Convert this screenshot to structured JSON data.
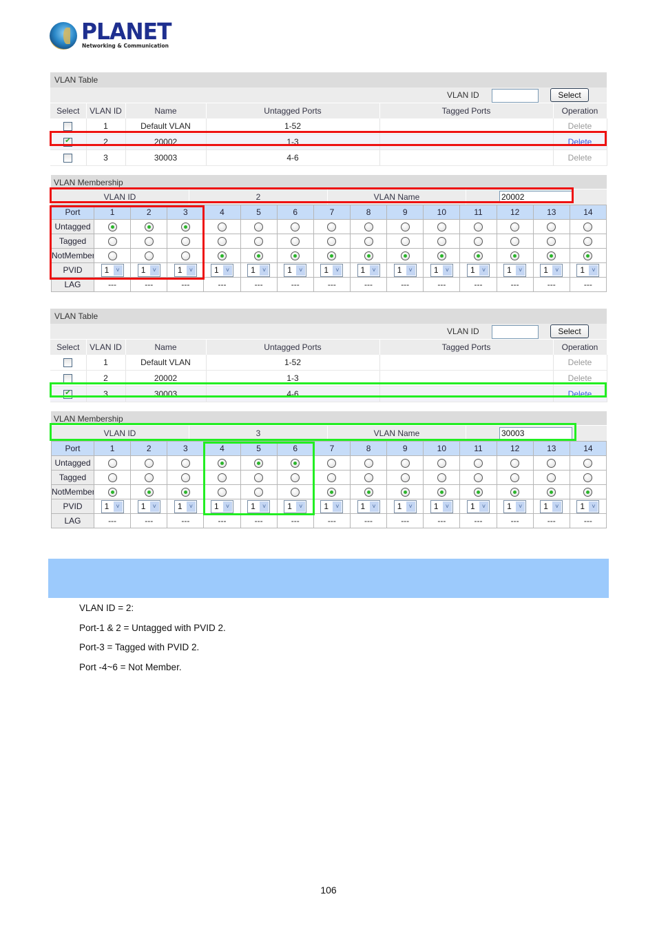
{
  "logo": {
    "brand": "PLANET",
    "tagline": "Networking & Communication",
    "icon": "globe-icon"
  },
  "vlan_table_1": {
    "title": "VLAN Table",
    "toolbar": {
      "vlan_id_label": "VLAN ID",
      "vlan_id_value": "",
      "select_button": "Select"
    },
    "columns": [
      "Select",
      "VLAN ID",
      "Name",
      "Untagged Ports",
      "Tagged Ports",
      "Operation"
    ],
    "rows": [
      {
        "selected": false,
        "vlan_id": "1",
        "name": "Default VLAN",
        "untagged": "1-52",
        "tagged": "",
        "operation": "Delete",
        "highlight": "none"
      },
      {
        "selected": true,
        "vlan_id": "2",
        "name": "20002",
        "untagged": "1-3",
        "tagged": "",
        "operation": "Delete",
        "highlight": "red"
      },
      {
        "selected": false,
        "vlan_id": "3",
        "name": "30003",
        "untagged": "4-6",
        "tagged": "",
        "operation": "Delete",
        "highlight": "none"
      }
    ]
  },
  "vlan_membership_1": {
    "title": "VLAN Membership",
    "vlan_id_label": "VLAN ID",
    "vlan_id_value": "2",
    "vlan_name_label": "VLAN Name",
    "vlan_name_value": "20002",
    "row_labels": {
      "port": "Port",
      "untagged": "Untagged",
      "tagged": "Tagged",
      "notmember": "NotMember",
      "pvid": "PVID",
      "lag": "LAG"
    },
    "ports": [
      "1",
      "2",
      "3",
      "4",
      "5",
      "6",
      "7",
      "8",
      "9",
      "10",
      "11",
      "12",
      "13",
      "14"
    ],
    "membership": [
      "untagged",
      "untagged",
      "untagged",
      "notmember",
      "notmember",
      "notmember",
      "notmember",
      "notmember",
      "notmember",
      "notmember",
      "notmember",
      "notmember",
      "notmember",
      "notmember"
    ],
    "pvid": [
      "1",
      "1",
      "1",
      "1",
      "1",
      "1",
      "1",
      "1",
      "1",
      "1",
      "1",
      "1",
      "1",
      "1"
    ],
    "lag": [
      "---",
      "---",
      "---",
      "---",
      "---",
      "---",
      "---",
      "---",
      "---",
      "---",
      "---",
      "---",
      "---",
      "---"
    ]
  },
  "vlan_table_2": {
    "title": "VLAN Table",
    "toolbar": {
      "vlan_id_label": "VLAN ID",
      "vlan_id_value": "",
      "select_button": "Select"
    },
    "columns": [
      "Select",
      "VLAN ID",
      "Name",
      "Untagged Ports",
      "Tagged Ports",
      "Operation"
    ],
    "rows": [
      {
        "selected": false,
        "vlan_id": "1",
        "name": "Default VLAN",
        "untagged": "1-52",
        "tagged": "",
        "operation": "Delete",
        "highlight": "none"
      },
      {
        "selected": false,
        "vlan_id": "2",
        "name": "20002",
        "untagged": "1-3",
        "tagged": "",
        "operation": "Delete",
        "highlight": "none"
      },
      {
        "selected": true,
        "vlan_id": "3",
        "name": "30003",
        "untagged": "4-6",
        "tagged": "",
        "operation": "Delete",
        "highlight": "green"
      }
    ]
  },
  "vlan_membership_2": {
    "title": "VLAN Membership",
    "vlan_id_label": "VLAN ID",
    "vlan_id_value": "3",
    "vlan_name_label": "VLAN Name",
    "vlan_name_value": "30003",
    "row_labels": {
      "port": "Port",
      "untagged": "Untagged",
      "tagged": "Tagged",
      "notmember": "NotMember",
      "pvid": "PVID",
      "lag": "LAG"
    },
    "ports": [
      "1",
      "2",
      "3",
      "4",
      "5",
      "6",
      "7",
      "8",
      "9",
      "10",
      "11",
      "12",
      "13",
      "14"
    ],
    "membership": [
      "notmember",
      "notmember",
      "notmember",
      "untagged",
      "untagged",
      "untagged",
      "notmember",
      "notmember",
      "notmember",
      "notmember",
      "notmember",
      "notmember",
      "notmember",
      "notmember"
    ],
    "pvid": [
      "1",
      "1",
      "1",
      "1",
      "1",
      "1",
      "1",
      "1",
      "1",
      "1",
      "1",
      "1",
      "1",
      "1"
    ],
    "lag": [
      "---",
      "---",
      "---",
      "---",
      "---",
      "---",
      "---",
      "---",
      "---",
      "---",
      "---",
      "---",
      "---",
      "---"
    ]
  },
  "colors": {
    "highlight_red": "#ee1111",
    "highlight_green": "#22ee22",
    "caption_bar": "#9ccafc",
    "port_header": "#c6dcf8",
    "delete_active": "#3355dd"
  },
  "notes": [
    "VLAN ID = 2:",
    "Port-1 & 2 = Untagged with PVID 2.",
    "Port-3 = Tagged with PVID 2.",
    "Port -4~6 = Not Member."
  ],
  "page_number": "106"
}
